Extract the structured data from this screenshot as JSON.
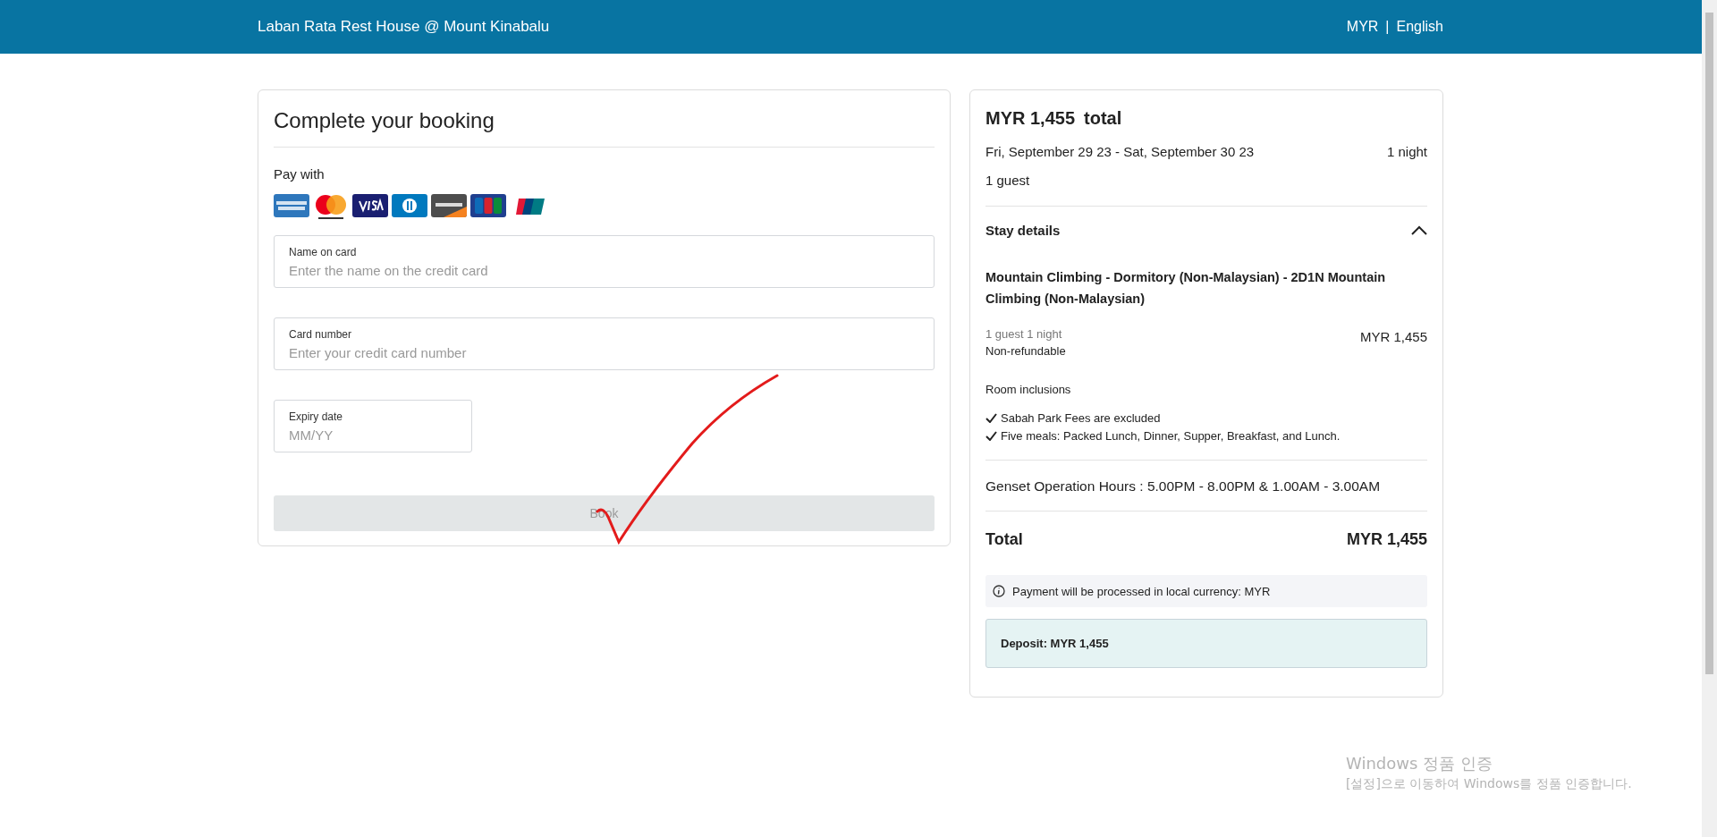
{
  "header": {
    "title": "Laban Rata Rest House @ Mount Kinabalu",
    "currency": "MYR",
    "separator": "|",
    "language": "English"
  },
  "booking_form": {
    "title": "Complete your booking",
    "pay_with": "Pay with",
    "fields": [
      {
        "kind": "wide",
        "label": "Name on card",
        "placeholder": "Enter the name on the credit card"
      },
      {
        "kind": "wide",
        "label": "Card number",
        "placeholder": "Enter your credit card number"
      },
      {
        "kind": "narrow",
        "label": "Expiry date",
        "placeholder": "MM/YY"
      }
    ],
    "book_button": {
      "label": "Book",
      "disabled": true
    }
  },
  "summary": {
    "amount": "MYR 1,455",
    "amount_suffix": "total",
    "dates": "Fri, September 29 23 - Sat, September 30 23",
    "nights": "1 night",
    "guests": "1 guest",
    "stay_details": {
      "title": "Stay details",
      "expanded": true,
      "room_name": "Mountain Climbing - Dormitory (Non-Malaysian) - 2D1N Mountain Climbing (Non-Malaysian)",
      "room_guests_nights": "1 guest 1 night",
      "refund_policy": "Non-refundable",
      "room_price": "MYR 1,455",
      "inclusions_title": "Room inclusions",
      "inclusions": [
        "Sabah Park Fees are excluded",
        "Five meals: Packed Lunch, Dinner, Supper, Breakfast, and Lunch."
      ]
    },
    "genset_note": "Genset Operation Hours : 5.00PM - 8.00PM & 1.00AM - 3.00AM",
    "total_label": "Total",
    "total_amount": "MYR 1,455",
    "payment_note": "Payment will be processed in local currency: MYR",
    "deposit": "Deposit: MYR 1,455"
  },
  "os_notice": {
    "title": "Windows 정품 인증",
    "message": "[설정]으로 이동하여 Windows를 정품 인증합니다."
  }
}
